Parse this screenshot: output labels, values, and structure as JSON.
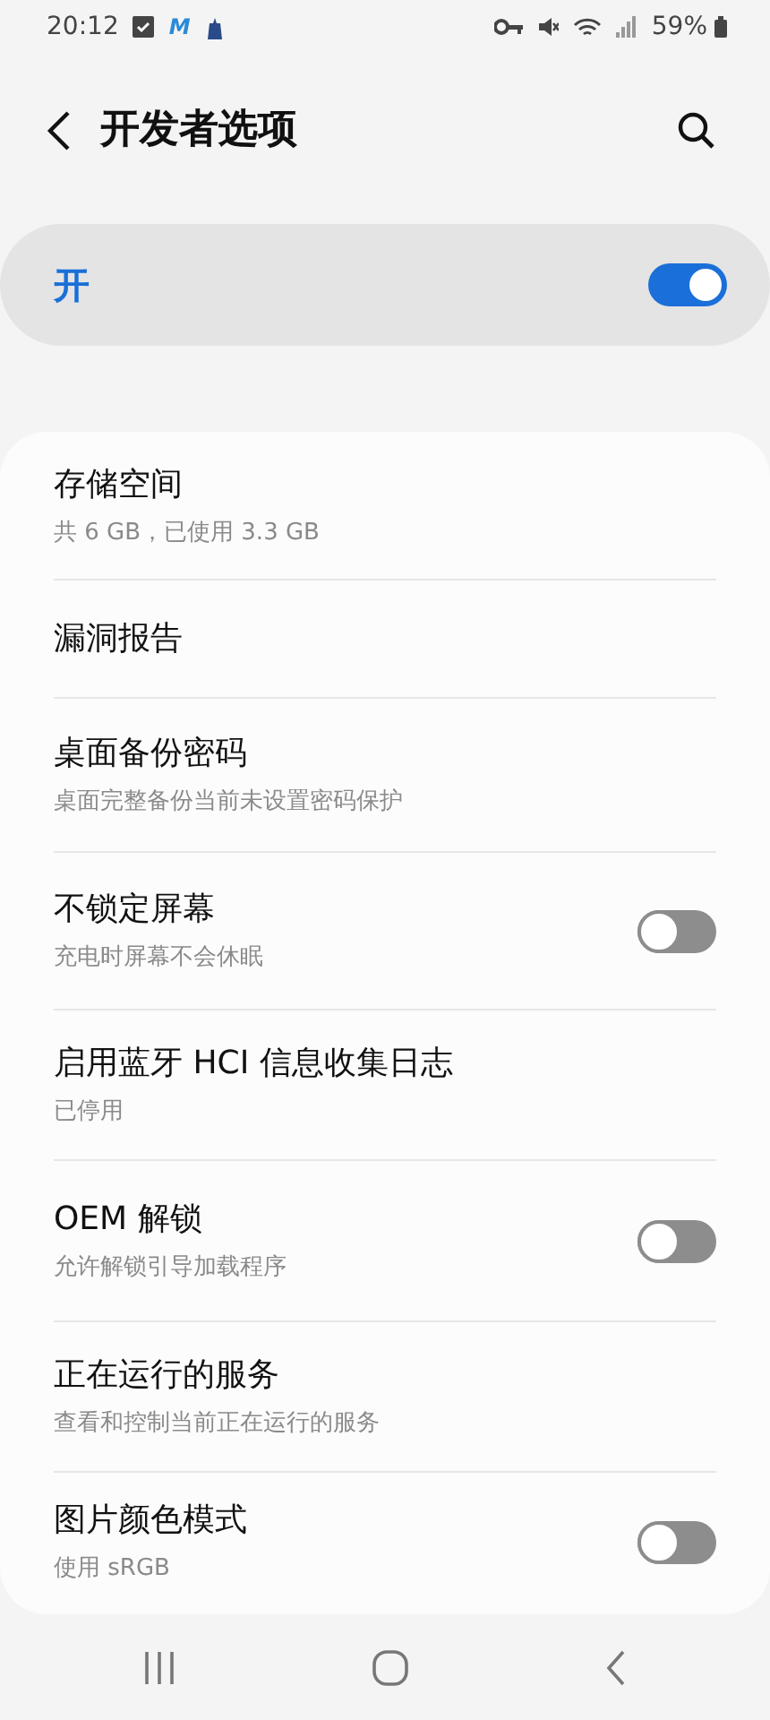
{
  "status_bar": {
    "time": "20:12",
    "app_letter": "M",
    "battery": "59%"
  },
  "header": {
    "title": "开发者选项"
  },
  "master_switch": {
    "label": "开",
    "on": true
  },
  "items": [
    {
      "kind": "text",
      "title": "存储空间",
      "subtitle": "共 6 GB，已使用 3.3 GB"
    },
    {
      "kind": "text",
      "title": "漏洞报告"
    },
    {
      "kind": "text",
      "title": "桌面备份密码",
      "subtitle": "桌面完整备份当前未设置密码保护"
    },
    {
      "kind": "toggle",
      "title": "不锁定屏幕",
      "subtitle": "充电时屏幕不会休眠",
      "on": false
    },
    {
      "kind": "text",
      "title": "启用蓝牙 HCI 信息收集日志",
      "subtitle": "已停用"
    },
    {
      "kind": "toggle",
      "title": "OEM 解锁",
      "subtitle": "允许解锁引导加载程序",
      "on": false
    },
    {
      "kind": "text",
      "title": "正在运行的服务",
      "subtitle": "查看和控制当前正在运行的服务"
    },
    {
      "kind": "toggle",
      "title": "图片颜色模式",
      "subtitle": "使用 sRGB",
      "on": false
    }
  ]
}
